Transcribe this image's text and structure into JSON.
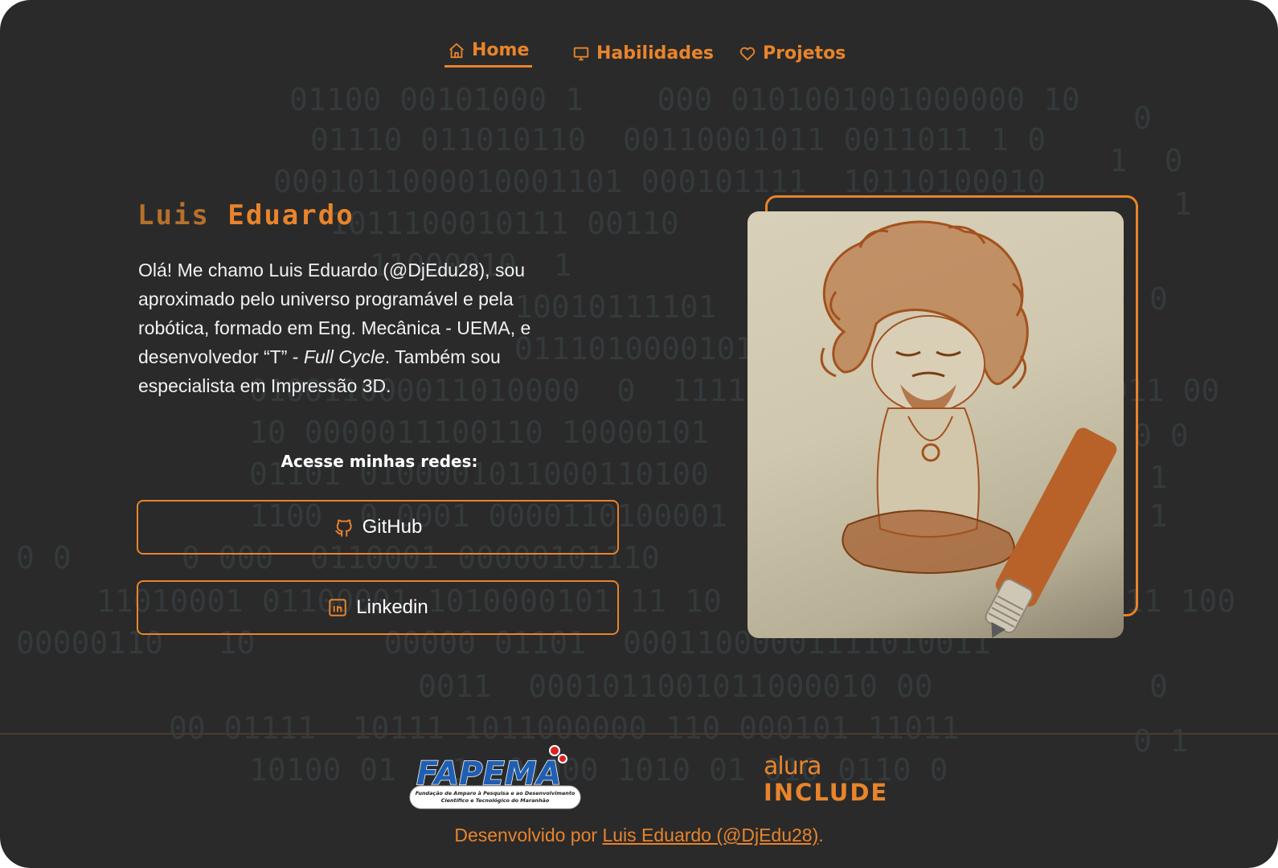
{
  "nav": {
    "items": [
      {
        "label": "Home",
        "icon": "home-icon",
        "active": true
      },
      {
        "label": "Habilidades",
        "icon": "monitor-icon",
        "active": false
      },
      {
        "label": "Projetos",
        "icon": "heart-icon",
        "active": false
      }
    ]
  },
  "hero": {
    "first_name": "Luis",
    "last_name": "Eduardo",
    "bio_1": "Olá! Me chamo Luis Eduardo (@DjEdu28), sou aproximado pelo universo programável e pela robótica, formado em Eng. Mecânica - UEMA, e desenvolvedor “T” - ",
    "bio_italic": "Full Cycle",
    "bio_2": ". Também sou especialista em Impressão 3D.",
    "networks_title": "Acesse minhas redes:",
    "github_label": "GitHub",
    "linkedin_label": "Linkedin"
  },
  "footer": {
    "fapema_logo": "FAPEMA",
    "fapema_caption_1": "Fundação de Amparo à Pesquisa e ao Desenvolvimento",
    "fapema_caption_2": "Científico e Tecnológico do Maranhão",
    "alura_top": "alura",
    "alura_bottom": "INCLUDE",
    "credits_prefix": "Desenvolvido por ",
    "credits_link": "Luis Eduardo (@DjEdu28)",
    "credits_suffix": "."
  },
  "colors": {
    "background": "#2a2a2a",
    "accent": "#e8842c",
    "text": "#f2f2f2"
  }
}
